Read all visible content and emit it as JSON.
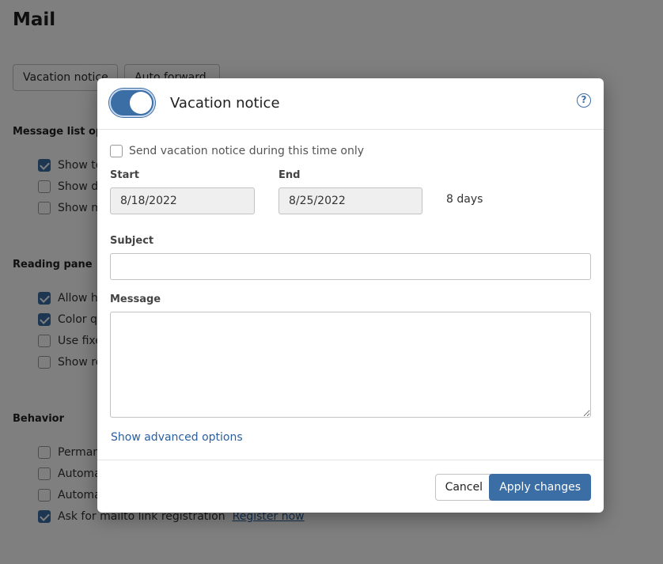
{
  "page": {
    "title": "Mail",
    "tabs": [
      {
        "label": "Vacation notice"
      },
      {
        "label": "Auto forward"
      }
    ],
    "sections": {
      "message_list": {
        "heading": "Message list options",
        "items": [
          {
            "label": "Show text preview",
            "checked": true
          },
          {
            "label": "Show date",
            "checked": false
          },
          {
            "label": "Show more",
            "checked": false
          }
        ]
      },
      "reading_pane": {
        "heading": "Reading pane",
        "items": [
          {
            "label": "Allow html",
            "checked": true
          },
          {
            "label": "Color quotes",
            "checked": true
          },
          {
            "label": "Use fixed",
            "checked": false
          },
          {
            "label": "Show re",
            "checked": false
          }
        ]
      },
      "behavior": {
        "heading": "Behavior",
        "items": [
          {
            "label": "Permane",
            "checked": false
          },
          {
            "label": "Automa",
            "checked": false
          },
          {
            "label": "Automa",
            "checked": false
          },
          {
            "label": "Ask for mailto link registration",
            "checked": true,
            "link": "Register now"
          }
        ]
      }
    }
  },
  "dialog": {
    "title": "Vacation notice",
    "toggle_on": true,
    "help_icon": "?",
    "only_during": {
      "label": "Send vacation notice during this time only",
      "checked": false
    },
    "start": {
      "label": "Start",
      "value": "8/18/2022"
    },
    "end": {
      "label": "End",
      "value": "8/25/2022"
    },
    "duration": "8 days",
    "subject": {
      "label": "Subject",
      "value": "",
      "placeholder": ""
    },
    "message": {
      "label": "Message",
      "value": "",
      "placeholder": ""
    },
    "advanced_link": "Show advanced options",
    "cancel_label": "Cancel",
    "apply_label": "Apply changes"
  },
  "colors": {
    "accent": "#3a6ea5",
    "link": "#2a5f9e",
    "overlay": "rgba(0,0,0,0.5)"
  }
}
